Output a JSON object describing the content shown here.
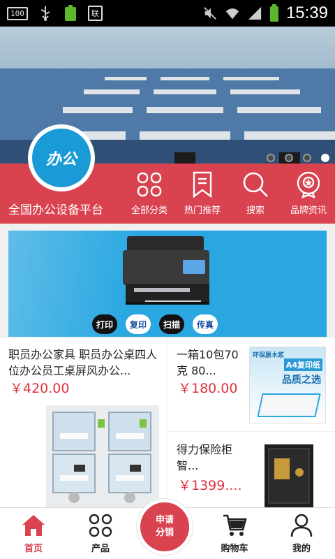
{
  "status_bar": {
    "battery_box": "100",
    "battery_pct": "100%",
    "sim_label": "联",
    "time": "15:39"
  },
  "header": {
    "logo_text": "办公",
    "site_title": "全国办公设备平台"
  },
  "nav": [
    {
      "label": "全部分类",
      "icon": "grid-icon"
    },
    {
      "label": "热门推荐",
      "icon": "bookmark-icon"
    },
    {
      "label": "搜索",
      "icon": "search-icon"
    },
    {
      "label": "品牌资讯",
      "icon": "medal-icon"
    }
  ],
  "banner": {
    "slides": 4,
    "active_slide": 4
  },
  "ad": {
    "pills": [
      "打印",
      "复印",
      "扫描",
      "传真"
    ]
  },
  "products": [
    {
      "name": "职员办公家具 职员办公桌四人位办公员工桌屏风办公...",
      "price": "￥420.00"
    },
    {
      "name": "一箱10包70克 80...",
      "price": "￥180.00",
      "image_text": [
        "环保原木浆",
        "A4复印纸",
        "品质之选"
      ]
    },
    {
      "name": "得力保险柜智...",
      "price": "￥1399...."
    }
  ],
  "tabbar": {
    "tabs": [
      {
        "label": "首页",
        "icon": "home-icon",
        "active": true
      },
      {
        "label": "产品",
        "icon": "grid-icon"
      },
      {
        "label": "购物车",
        "icon": "cart-icon"
      },
      {
        "label": "我的",
        "icon": "user-icon"
      }
    ],
    "fab_line1": "申请",
    "fab_line2": "分销"
  },
  "colors": {
    "brand_red": "#d9424f",
    "price_red": "#e0313f",
    "logo_blue": "#1a9bd7",
    "ad_blue": "#2aa7e1"
  }
}
